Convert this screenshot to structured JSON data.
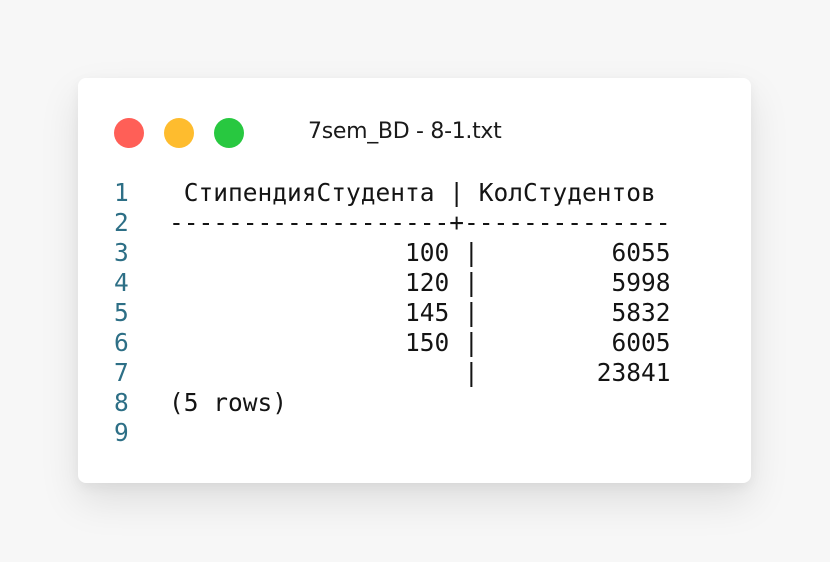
{
  "window": {
    "title": "7sem_BD - 8-1.txt",
    "controls": {
      "close_color": "#ff5f57",
      "minimize_color": "#febc2e",
      "maximize_color": "#28c840"
    }
  },
  "editor": {
    "lines": [
      {
        "num": "1",
        "text": " СтипендияСтудента | КолСтудентов"
      },
      {
        "num": "2",
        "text": "-------------------+--------------"
      },
      {
        "num": "3",
        "text": "                100 |         6055"
      },
      {
        "num": "4",
        "text": "                120 |         5998"
      },
      {
        "num": "5",
        "text": "                145 |         5832"
      },
      {
        "num": "6",
        "text": "                150 |         6005"
      },
      {
        "num": "7",
        "text": "                    |        23841"
      },
      {
        "num": "8",
        "text": "(5 rows)"
      },
      {
        "num": "9",
        "text": ""
      }
    ]
  }
}
